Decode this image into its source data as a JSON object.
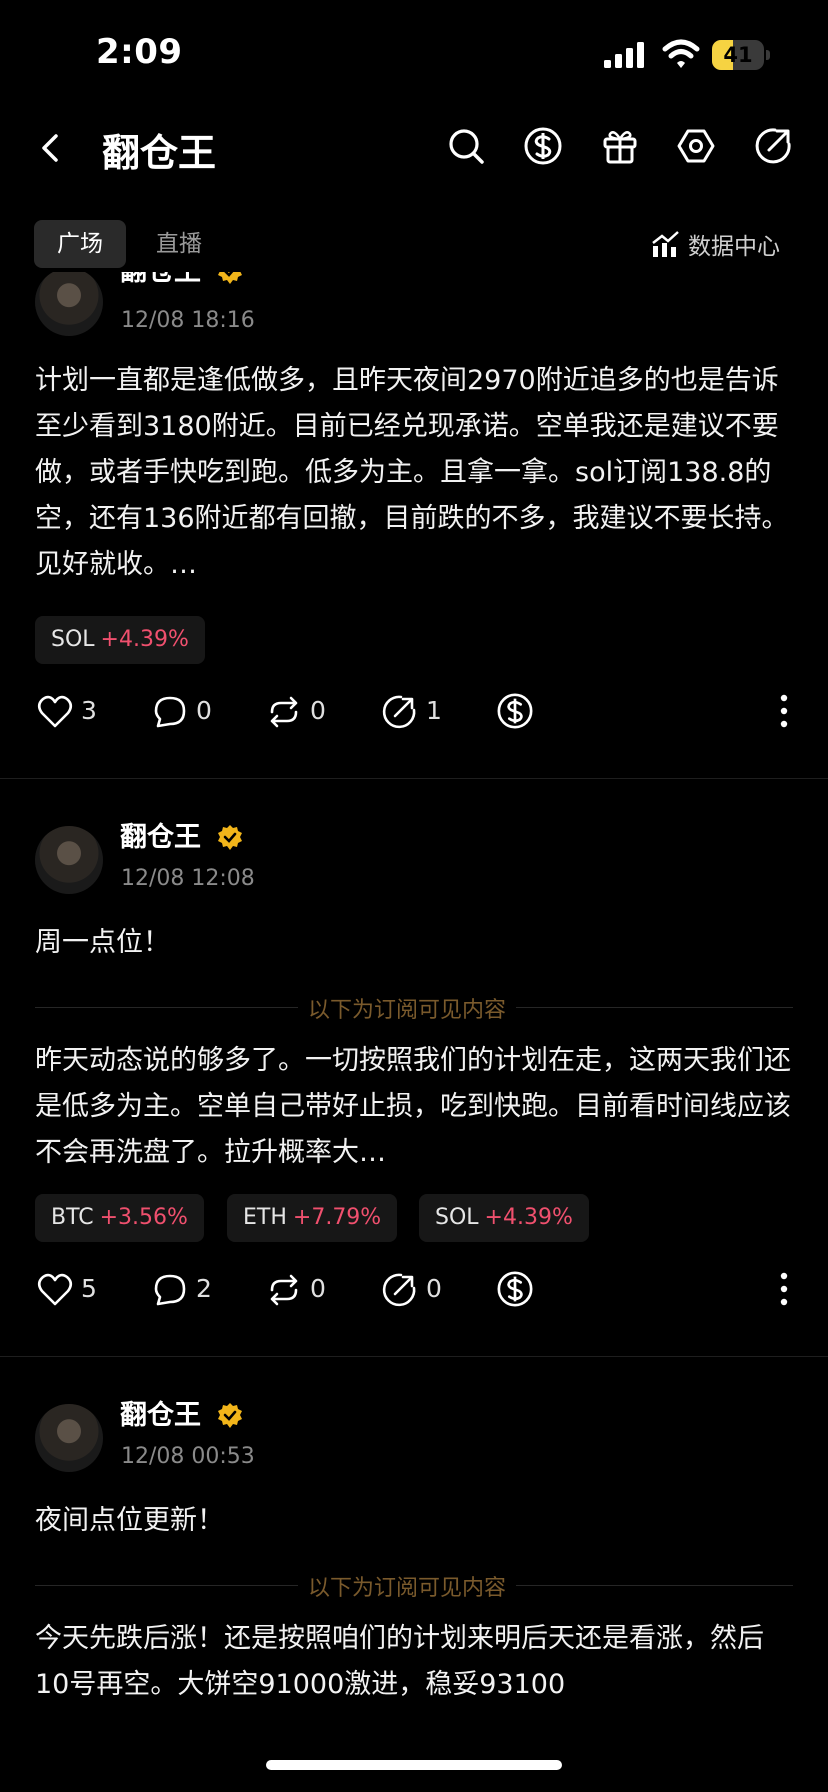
{
  "status": {
    "time": "2:09",
    "battery": "41",
    "battery_level": 0.41
  },
  "nav": {
    "title": "翻仓王"
  },
  "tabs": {
    "active": "广场",
    "other": "直播",
    "data_center": "数据中心"
  },
  "posts": [
    {
      "author": "翻仓王",
      "date": "12/08 18:16",
      "text": "计划一直都是逢低做多，且昨天夜间2970附近追多的也是告诉至少看到3180附近。目前已经兑现承诺。空单我还是建议不要做，或者手快吃到跑。低多为主。且拿一拿。sol订阅138.8的空，还有136附近都有回撤，目前跌的不多，我建议不要长持。见好就收。…",
      "chips": [
        {
          "name": "SOL",
          "pct": "+4.39%"
        }
      ],
      "likes": "3",
      "comments": "0",
      "reposts": "0",
      "shares": "1"
    },
    {
      "author": "翻仓王",
      "date": "12/08 12:08",
      "title": "周一点位！",
      "sub_label": "以下为订阅可见内容",
      "text": "昨天动态说的够多了。一切按照我们的计划在走，这两天我们还是低多为主。空单自己带好止损，吃到快跑。目前看时间线应该不会再洗盘了。拉升概率大…",
      "chips": [
        {
          "name": "BTC",
          "pct": "+3.56%"
        },
        {
          "name": "ETH",
          "pct": "+7.79%"
        },
        {
          "name": "SOL",
          "pct": "+4.39%"
        }
      ],
      "likes": "5",
      "comments": "2",
      "reposts": "0",
      "shares": "0"
    },
    {
      "author": "翻仓王",
      "date": "12/08 00:53",
      "title": "夜间点位更新！",
      "sub_label": "以下为订阅可见内容",
      "text": "今天先跌后涨！还是按照咱们的计划来明后天还是看涨，然后10号再空。大饼空91000激进，稳妥93100"
    }
  ]
}
